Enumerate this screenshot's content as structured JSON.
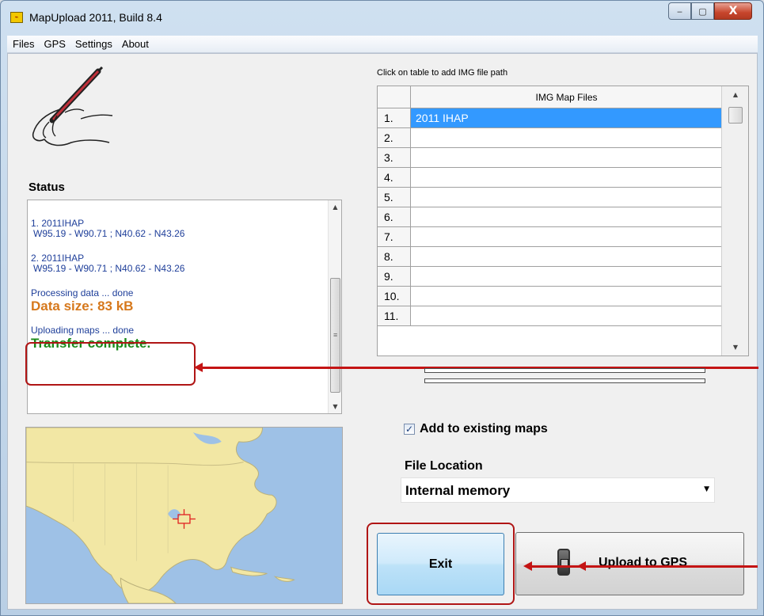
{
  "window": {
    "title": "MapUpload 2011, Build 8.4",
    "min_glyph": "‒",
    "max_glyph": "▢",
    "close_glyph": "X"
  },
  "menu": [
    "Files",
    "GPS",
    "Settings",
    "About"
  ],
  "status": {
    "title": "Status",
    "entries": [
      {
        "name": "1. 2011IHAP",
        "coords": "W95.19 - W90.71  ;  N40.62 - N43.26"
      },
      {
        "name": "2. 2011IHAP",
        "coords": "W95.19 - W90.71  ;  N40.62 - N43.26"
      }
    ],
    "processing": "Processing data ... done",
    "data_size": "Data size: 83 kB",
    "uploading": "Uploading maps ... done",
    "transfer": "Transfer complete."
  },
  "table": {
    "caption": "Click on table to add IMG file path",
    "column_header": "IMG Map Files",
    "rows": [
      {
        "num": "1.",
        "value": "2011 IHAP",
        "selected": true
      },
      {
        "num": "2.",
        "value": ""
      },
      {
        "num": "3.",
        "value": ""
      },
      {
        "num": "4.",
        "value": ""
      },
      {
        "num": "5.",
        "value": ""
      },
      {
        "num": "6.",
        "value": ""
      },
      {
        "num": "7.",
        "value": ""
      },
      {
        "num": "8.",
        "value": ""
      },
      {
        "num": "9.",
        "value": ""
      },
      {
        "num": "10.",
        "value": ""
      },
      {
        "num": "11.",
        "value": ""
      }
    ]
  },
  "options": {
    "add_existing_label": "Add to existing maps",
    "add_existing_checked": true,
    "file_location_label": "File Location",
    "file_location_value": "Internal memory"
  },
  "buttons": {
    "exit": "Exit",
    "upload": "Upload to GPS"
  },
  "colors": {
    "status_text": "#1f3f9a",
    "data_size": "#d6781c",
    "transfer_complete": "#1a8a1a",
    "selection": "#3399ff",
    "annotation": "#c41414",
    "map_water": "#9ec1e6",
    "map_land": "#f2e7a4"
  }
}
